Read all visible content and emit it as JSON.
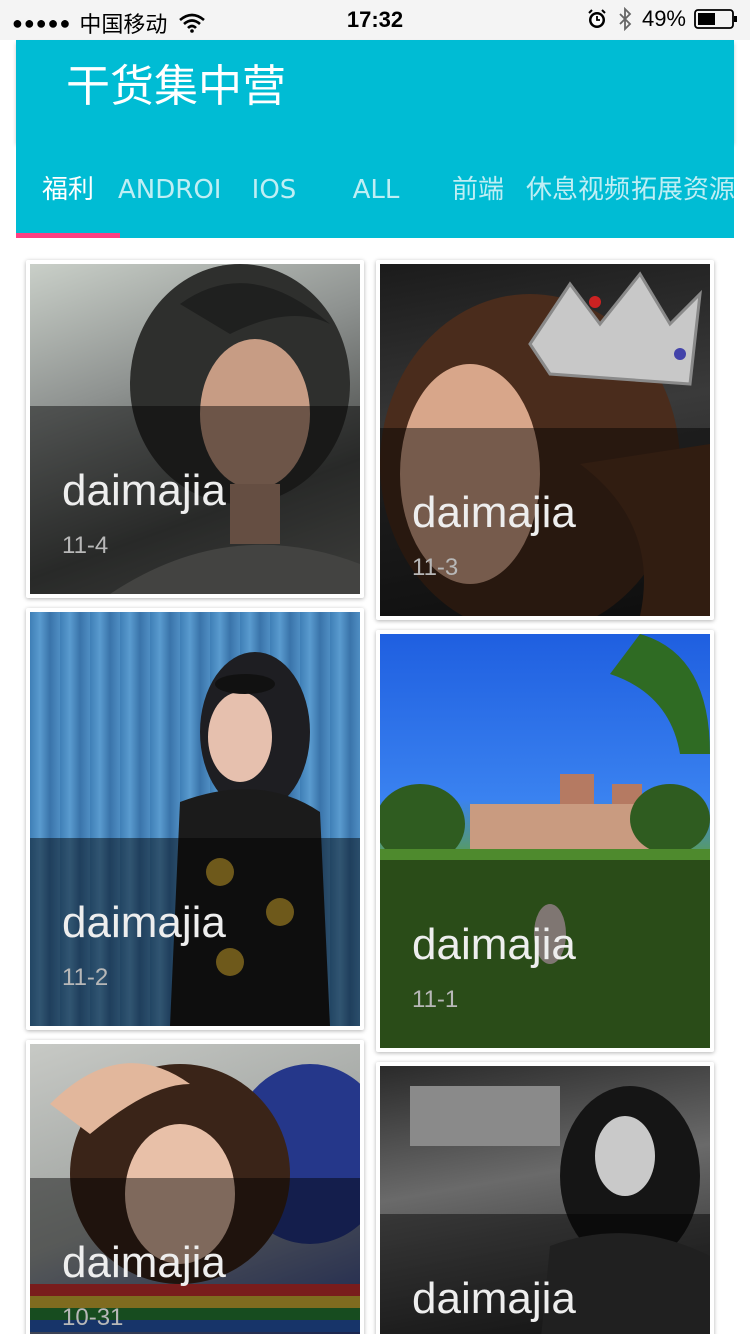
{
  "status_bar": {
    "signal": "●●●●●",
    "carrier": "中国移动",
    "time": "17:32",
    "battery": "49%"
  },
  "app": {
    "title": "干货集中营",
    "primary_color": "#00bcd4",
    "indicator_color": "#ff4081"
  },
  "tabs": [
    {
      "label": "福利",
      "active": true
    },
    {
      "label": "ANDROID"
    },
    {
      "label": "IOS"
    },
    {
      "label": "ALL"
    },
    {
      "label": "前端"
    },
    {
      "label": "休息视频"
    },
    {
      "label": "拓展资源"
    }
  ],
  "cards": [
    {
      "author": "daimajia",
      "date": "11-4"
    },
    {
      "author": "daimajia",
      "date": "11-3"
    },
    {
      "author": "daimajia",
      "date": "11-2"
    },
    {
      "author": "daimajia",
      "date": "11-1"
    },
    {
      "author": "daimajia",
      "date": "10-31"
    },
    {
      "author": "daimajia",
      "date": ""
    }
  ]
}
